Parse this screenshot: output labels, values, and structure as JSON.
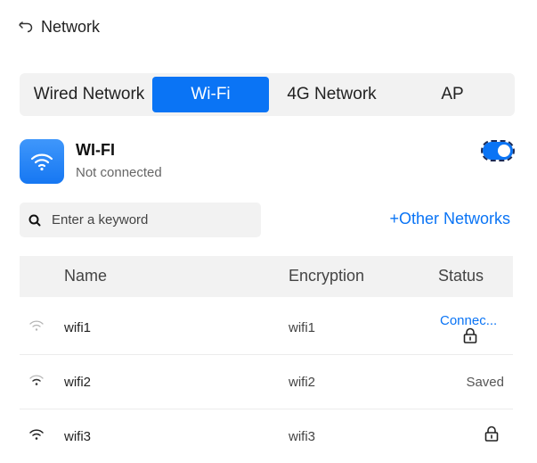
{
  "header": {
    "title": "Network",
    "back_icon": "back-arrow-icon"
  },
  "tabs": [
    {
      "label": "Wired Network",
      "active": false
    },
    {
      "label": "Wi-Fi",
      "active": true
    },
    {
      "label": "4G Network",
      "active": false
    },
    {
      "label": "AP",
      "active": false
    }
  ],
  "wifi": {
    "name": "WI-FI",
    "status": "Not connected",
    "enabled": true,
    "icon": "wifi-icon",
    "accent": "#0a74f5"
  },
  "search": {
    "placeholder": "Enter a keyword",
    "value": "",
    "icon": "search-icon"
  },
  "other_networks": "+Other Networks",
  "table": {
    "columns": [
      "Name",
      "Encryption",
      "Status"
    ],
    "rows": [
      {
        "name": "wifi1",
        "encryption": "wifi1",
        "status": "Connec...",
        "locked": true
      },
      {
        "name": "wifi2",
        "encryption": "wifi2",
        "status": "Saved",
        "locked": false
      },
      {
        "name": "wifi3",
        "encryption": "wifi3",
        "status": "",
        "locked": true
      }
    ]
  }
}
